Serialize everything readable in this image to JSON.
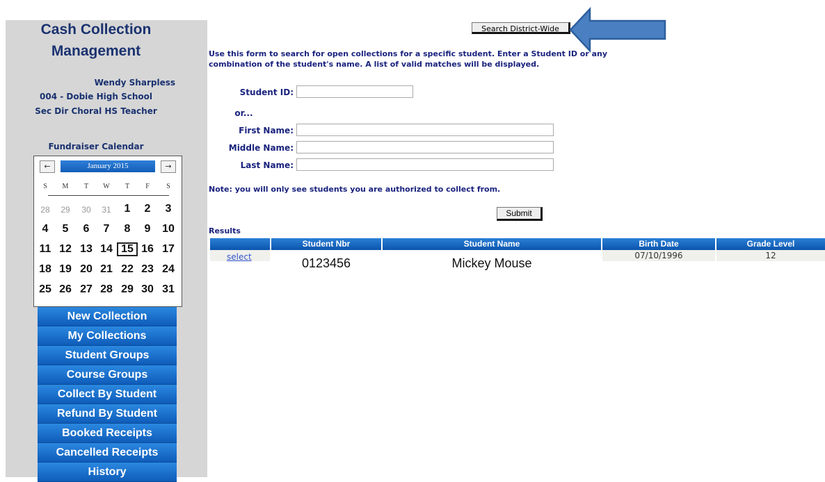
{
  "sidebar": {
    "app_title_line1": "Cash Collection",
    "app_title_line2": "Management",
    "user": {
      "name": "Wendy Sharpless",
      "school": "004 - Dobie High School",
      "role": "Sec Dir Choral HS Teacher"
    },
    "calendar": {
      "heading": "Fundraiser Calendar",
      "month": "January 2015",
      "prev_icon": "left-arrow-icon",
      "next_icon": "right-arrow-icon",
      "weekdays": [
        "S",
        "M",
        "T",
        "W",
        "T",
        "F",
        "S"
      ],
      "weeks": [
        [
          "28",
          "29",
          "30",
          "31",
          "1",
          "2",
          "3"
        ],
        [
          "4",
          "5",
          "6",
          "7",
          "8",
          "9",
          "10"
        ],
        [
          "11",
          "12",
          "13",
          "14",
          "15",
          "16",
          "17"
        ],
        [
          "18",
          "19",
          "20",
          "21",
          "22",
          "23",
          "24"
        ],
        [
          "25",
          "26",
          "27",
          "28",
          "29",
          "30",
          "31"
        ]
      ],
      "today": "15"
    },
    "menu": [
      "New Collection",
      "My Collections",
      "Student Groups",
      "Course Groups",
      "Collect By Student",
      "Refund By Student",
      "Booked Receipts",
      "Cancelled Receipts",
      "History"
    ]
  },
  "main": {
    "district_button": "Search District-Wide",
    "instructions": "Use this form to search for open collections for a specific student. Enter a Student ID or any combination of the student's name. A list of valid matches will be displayed.",
    "form": {
      "student_id_label": "Student ID:",
      "or_label": "or...",
      "first_name_label": "First Name:",
      "middle_name_label": "Middle Name:",
      "last_name_label": "Last Name:",
      "student_id_value": "",
      "first_name_value": "",
      "middle_name_value": "",
      "last_name_value": ""
    },
    "note": "Note: you will only see students you are authorized to collect from.",
    "submit": "Submit",
    "results_label": "Results",
    "table": {
      "columns": [
        "",
        "Student Nbr",
        "Student Name",
        "Birth Date",
        "Grade Level"
      ],
      "rows": [
        {
          "action": "select",
          "student_nbr": "0123456",
          "student_name": "Mickey Mouse",
          "birth_date": "07/10/1996",
          "grade_level": "12"
        }
      ]
    },
    "annotation": {
      "arrow_color": "#4a7fc1",
      "arrow_stroke": "#2d5f9e"
    }
  }
}
